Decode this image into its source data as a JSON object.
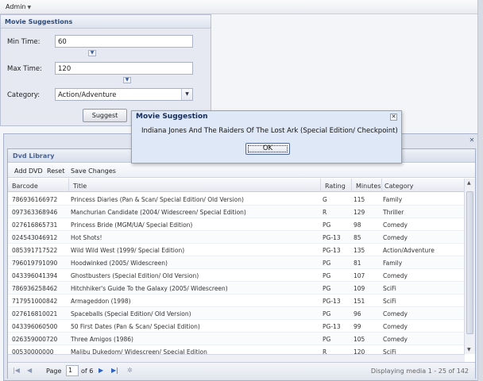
{
  "topbar": {
    "admin_label": "Admin"
  },
  "form": {
    "title": "Movie Suggestions",
    "min_time_label": "Min Time:",
    "min_time_value": "60",
    "max_time_label": "Max Time:",
    "max_time_value": "120",
    "category_label": "Category:",
    "category_value": "Action/Adventure",
    "suggest_label": "Suggest"
  },
  "modal": {
    "title": "Movie Suggestion",
    "message": "Indiana Jones And The Raiders Of The Lost Ark (Special Edition/ Checkpoint)",
    "ok_label": "OK"
  },
  "library": {
    "title": "Dvd Library",
    "toolbar": {
      "add": "Add DVD",
      "reset": "Reset",
      "save": "Save Changes"
    },
    "columns": {
      "barcode": "Barcode",
      "title": "Title",
      "rating": "Rating",
      "minutes": "Minutes",
      "category": "Category"
    },
    "rows": [
      {
        "barcode": "786936166972",
        "title": "Princess Diaries (Pan & Scan/ Special Edition/ Old Version)",
        "rating": "G",
        "minutes": "115",
        "category": "Family"
      },
      {
        "barcode": "097363368946",
        "title": "Manchurian Candidate (2004/ Widescreen/ Special Edition)",
        "rating": "R",
        "minutes": "129",
        "category": "Thriller"
      },
      {
        "barcode": "027616865731",
        "title": "Princess Bride (MGM/UA/ Special Edition)",
        "rating": "PG",
        "minutes": "98",
        "category": "Comedy"
      },
      {
        "barcode": "024543046912",
        "title": "Hot Shots!",
        "rating": "PG-13",
        "minutes": "85",
        "category": "Comedy"
      },
      {
        "barcode": "085391717522",
        "title": "Wild Wild West (1999/ Special Edition)",
        "rating": "PG-13",
        "minutes": "135",
        "category": "Action/Adventure"
      },
      {
        "barcode": "796019791090",
        "title": "Hoodwinked (2005/ Widescreen)",
        "rating": "PG",
        "minutes": "81",
        "category": "Family"
      },
      {
        "barcode": "043396041394",
        "title": "Ghostbusters (Special Edition/ Old Version)",
        "rating": "PG",
        "minutes": "107",
        "category": "Comedy"
      },
      {
        "barcode": "786936258462",
        "title": "Hitchhiker's Guide To the Galaxy (2005/ Widescreen)",
        "rating": "PG",
        "minutes": "109",
        "category": "SciFi"
      },
      {
        "barcode": "717951000842",
        "title": "Armageddon (1998)",
        "rating": "PG-13",
        "minutes": "151",
        "category": "SciFi"
      },
      {
        "barcode": "027616810021",
        "title": "Spaceballs (Special Edition/ Old Version)",
        "rating": "PG",
        "minutes": "96",
        "category": "Comedy"
      },
      {
        "barcode": "043396060500",
        "title": "50 First Dates (Pan & Scan/ Special Edition)",
        "rating": "PG-13",
        "minutes": "99",
        "category": "Comedy"
      },
      {
        "barcode": "026359000720",
        "title": "Three Amigos (1986)",
        "rating": "PG",
        "minutes": "105",
        "category": "Comedy"
      },
      {
        "barcode": "00530000000",
        "title": "Malibu Dukedom/ Widescreen/ Special Edition",
        "rating": "R",
        "minutes": "120",
        "category": "SciFi"
      }
    ],
    "pager": {
      "page_label": "Page",
      "page_value": "1",
      "of_label": "of 6",
      "display_text": "Displaying media 1 - 25 of 142"
    }
  }
}
